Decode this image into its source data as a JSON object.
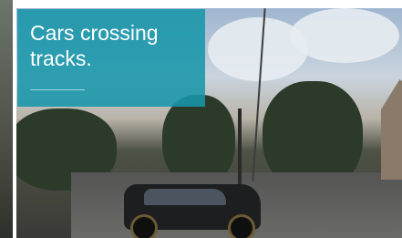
{
  "caption": {
    "text": "Cars crossing tracks."
  },
  "scene": {
    "description_icon": "street-scene-image"
  },
  "colors": {
    "caption_bg": "#1896aa",
    "caption_text": "#ffffff"
  }
}
